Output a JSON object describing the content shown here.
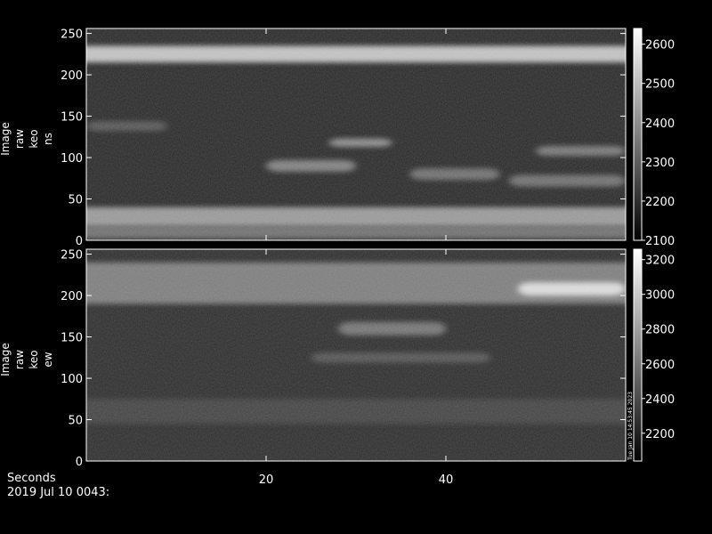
{
  "chart_data": [
    {
      "type": "heatmap",
      "ylabel": [
        "Image",
        "raw",
        "keo",
        "ns"
      ],
      "yticks": [
        0,
        50,
        100,
        150,
        200,
        250
      ],
      "ylim": [
        0,
        256
      ],
      "xlim": [
        0,
        60
      ],
      "colorbar": {
        "ticks": [
          2100,
          2200,
          2300,
          2400,
          2500,
          2600
        ],
        "range": [
          2100,
          2640
        ],
        "colormap": "grayscale"
      },
      "features": [
        {
          "y": 225,
          "value": 2560,
          "spread": 10
        },
        {
          "y": 28,
          "value": 2460,
          "spread": 12
        },
        {
          "y": 10,
          "value": 2360,
          "spread": 8
        },
        {
          "y": 138,
          "value": 2300,
          "spread": 6,
          "x_range": [
            0,
            9
          ]
        },
        {
          "y": 118,
          "value": 2430,
          "spread": 5,
          "x_range": [
            27,
            34
          ]
        },
        {
          "y": 90,
          "value": 2400,
          "spread": 7,
          "x_range": [
            20,
            30
          ]
        },
        {
          "y": 80,
          "value": 2360,
          "spread": 7,
          "x_range": [
            36,
            46
          ]
        },
        {
          "y": 72,
          "value": 2360,
          "spread": 7,
          "x_range": [
            47,
            60
          ]
        },
        {
          "y": 108,
          "value": 2380,
          "spread": 6,
          "x_range": [
            50,
            60
          ]
        }
      ]
    },
    {
      "type": "heatmap",
      "ylabel": [
        "Image",
        "raw",
        "keo",
        "ew"
      ],
      "yticks": [
        0,
        50,
        100,
        150,
        200,
        250
      ],
      "ylim": [
        0,
        256
      ],
      "xlim": [
        0,
        60
      ],
      "colorbar": {
        "ticks": [
          2200,
          2400,
          2600,
          2800,
          3000,
          3200
        ],
        "range": [
          2040,
          3260
        ],
        "colormap": "grayscale",
        "side_label": "Tue Jan 10 14:53:45 2023"
      },
      "features": [
        {
          "y": 215,
          "value": 2700,
          "spread": 25
        },
        {
          "y": 208,
          "value": 3150,
          "spread": 8,
          "x_range": [
            48,
            60
          ]
        },
        {
          "y": 160,
          "value": 2650,
          "spread": 8,
          "x_range": [
            28,
            40
          ]
        },
        {
          "y": 125,
          "value": 2480,
          "spread": 6,
          "x_range": [
            25,
            45
          ]
        },
        {
          "y": 60,
          "value": 2380,
          "spread": 15
        }
      ]
    }
  ],
  "xaxis": {
    "label": "Seconds",
    "ticks": [
      20,
      40
    ]
  },
  "date_label": "2019 Jul 10 0043:"
}
